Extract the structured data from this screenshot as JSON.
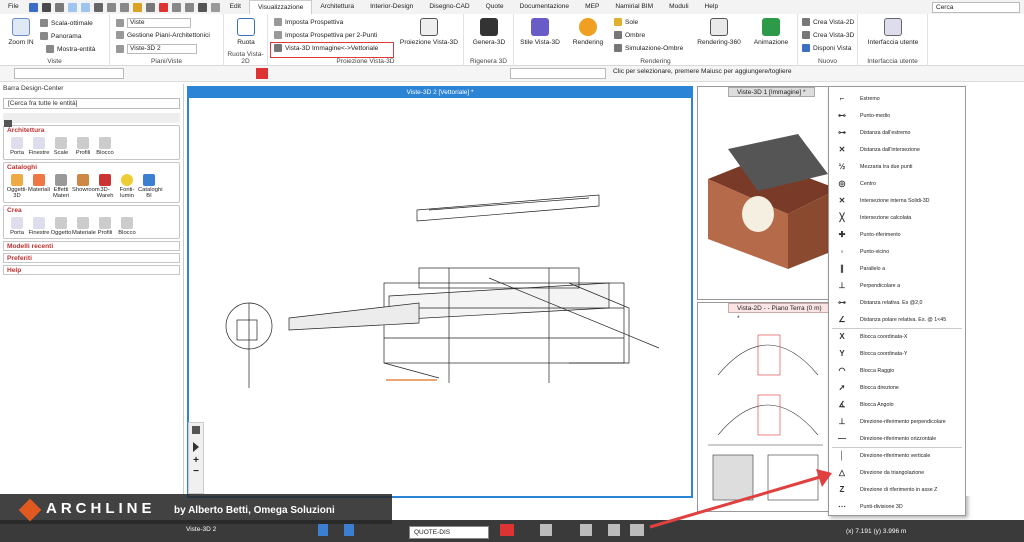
{
  "menubar": {
    "tabs": [
      "File",
      "Edit",
      "Visualizzazione",
      "Architettura",
      "Interior-Design",
      "Disegno-CAD",
      "Quote",
      "Documentazione",
      "MEP",
      "Namirial BIM",
      "Moduli",
      "Help"
    ],
    "search_placeholder": "Cerca"
  },
  "ribbon": {
    "viste": {
      "label": "Viste",
      "zoom": "Zoom IN",
      "scala": "Scala-ottimale",
      "panorama": "Panorama",
      "mostra": "Mostra-entità"
    },
    "piani": {
      "label": "Piani/Viste",
      "viste_dd": "Viste",
      "gestione": "Gestione Piani-Architettonici",
      "vista_dd": "Viste-3D 2"
    },
    "ruota": {
      "label": "Ruota Vista-2D",
      "btn": "Ruota"
    },
    "proiezione": {
      "label": "Proiezione Vista-3D",
      "imposta": "Imposta Prospettiva",
      "imposta2": "Imposta Prospettiva per 2-Punti",
      "vettoriale": "Vista-3D Immagine<->Vettoriale",
      "btn": "Proiezione Vista-3D"
    },
    "rigenera": {
      "label": "Rigenera 3D",
      "btn": "Genera-3D"
    },
    "rendering": {
      "label": "Rendering",
      "stile": "Stile Vista-3D",
      "rendering": "Rendering",
      "sole": "Sole",
      "ombre": "Ombre",
      "simulazione": "Simulazione-Ombre",
      "r360": "Rendering-360",
      "anim": "Animazione"
    },
    "nuovo": {
      "label": "Nuovo",
      "v2d": "Crea Vista-2D",
      "v3d": "Crea Vista-3D",
      "disponi": "Disponi Vista"
    },
    "iu": {
      "label": "Interfaccia utente",
      "btn": "Interfaccia utente"
    }
  },
  "hint": "Clic per selezionare, premere Maiusc per aggiungere/togliere",
  "sidebar": {
    "title": "Barra Design-Center",
    "search": "[Cerca fra tutte le entità]",
    "architettura": {
      "head": "Architettura",
      "items": [
        "Porta",
        "Finestre",
        "Scale",
        "Profili",
        "Blocco"
      ]
    },
    "cataloghi": {
      "head": "Cataloghi",
      "items": [
        "Oggetti-3D",
        "Materiali",
        "Effetti Materi",
        "Showroom",
        "3D-Wareh",
        "Fonti-lumin",
        "Cataloghi BI"
      ]
    },
    "crea": {
      "head": "Crea",
      "items": [
        "Porta",
        "Finestre",
        "Oggetto",
        "Materiale",
        "Profili",
        "Blocco"
      ]
    },
    "collapsed": [
      "Modelli recenti",
      "Preferiti",
      "Help"
    ]
  },
  "viewports": {
    "vp1": "Viste-3D 2 [Vettoriale] *",
    "vp2": "Viste-3D 1 [Immagine] *",
    "vp3": "Vista-2D - - Piano Terra (0 m) *"
  },
  "snapmenu": [
    {
      "label": "Estremo",
      "icon": "⌐"
    },
    {
      "label": "Punto-medio",
      "icon": "⊷"
    },
    {
      "label": "Distanza dall'estremo",
      "icon": "⊶"
    },
    {
      "label": "Distanza dall'intersezione",
      "icon": "✕"
    },
    {
      "label": "Mezzaria tra due punti",
      "icon": "½"
    },
    {
      "label": "Centro",
      "icon": "◎"
    },
    {
      "label": "Intersezione interna Solidi-3D",
      "icon": "✕"
    },
    {
      "label": "Intersezione calcolata",
      "icon": "╳"
    },
    {
      "label": "Punto-riferimento",
      "icon": "✚"
    },
    {
      "label": "Punto-vicino",
      "icon": "◦"
    },
    {
      "label": "Parallelo a",
      "icon": "∥"
    },
    {
      "label": "Perpendicolare a",
      "icon": "⊥"
    },
    {
      "label": "Distanza relativa. Es @2,0",
      "icon": "⊶"
    },
    {
      "label": "Distanza polare relativa. Es. @ 1<45",
      "icon": "∠"
    },
    {
      "label": "Blocca coordinata-X",
      "icon": "X"
    },
    {
      "label": "Blocca coordinata-Y",
      "icon": "Y"
    },
    {
      "label": "Blocca Raggio",
      "icon": "◠"
    },
    {
      "label": "Blocca direzione",
      "icon": "➚"
    },
    {
      "label": "Blocca Angolo",
      "icon": "∡"
    },
    {
      "label": "Direzione-riferimento perpendicolare",
      "icon": "⊥"
    },
    {
      "label": "Direzione-riferimento orizzontale",
      "icon": "—"
    },
    {
      "label": "Direzione-riferimento verticale",
      "icon": "│"
    },
    {
      "label": "Direzione da triangolazione",
      "icon": "△"
    },
    {
      "label": "Direzione di riferimento in asse Z",
      "icon": "Z"
    },
    {
      "label": "Punti-divisione 3D",
      "icon": "⋯"
    }
  ],
  "bottom": {
    "brand": "ARCHLINE",
    "by": "by Alberto Betti, Omega Soluzioni",
    "coord": "(x) 7.191  (y) 3.996 m",
    "quote": "QUOTE-DIS",
    "vista": "Viste-3D 2"
  },
  "colors": {
    "accent": "#2b84d6",
    "highlight": "#e23a3a",
    "section": "#c03030",
    "arrow": "#e04040"
  }
}
